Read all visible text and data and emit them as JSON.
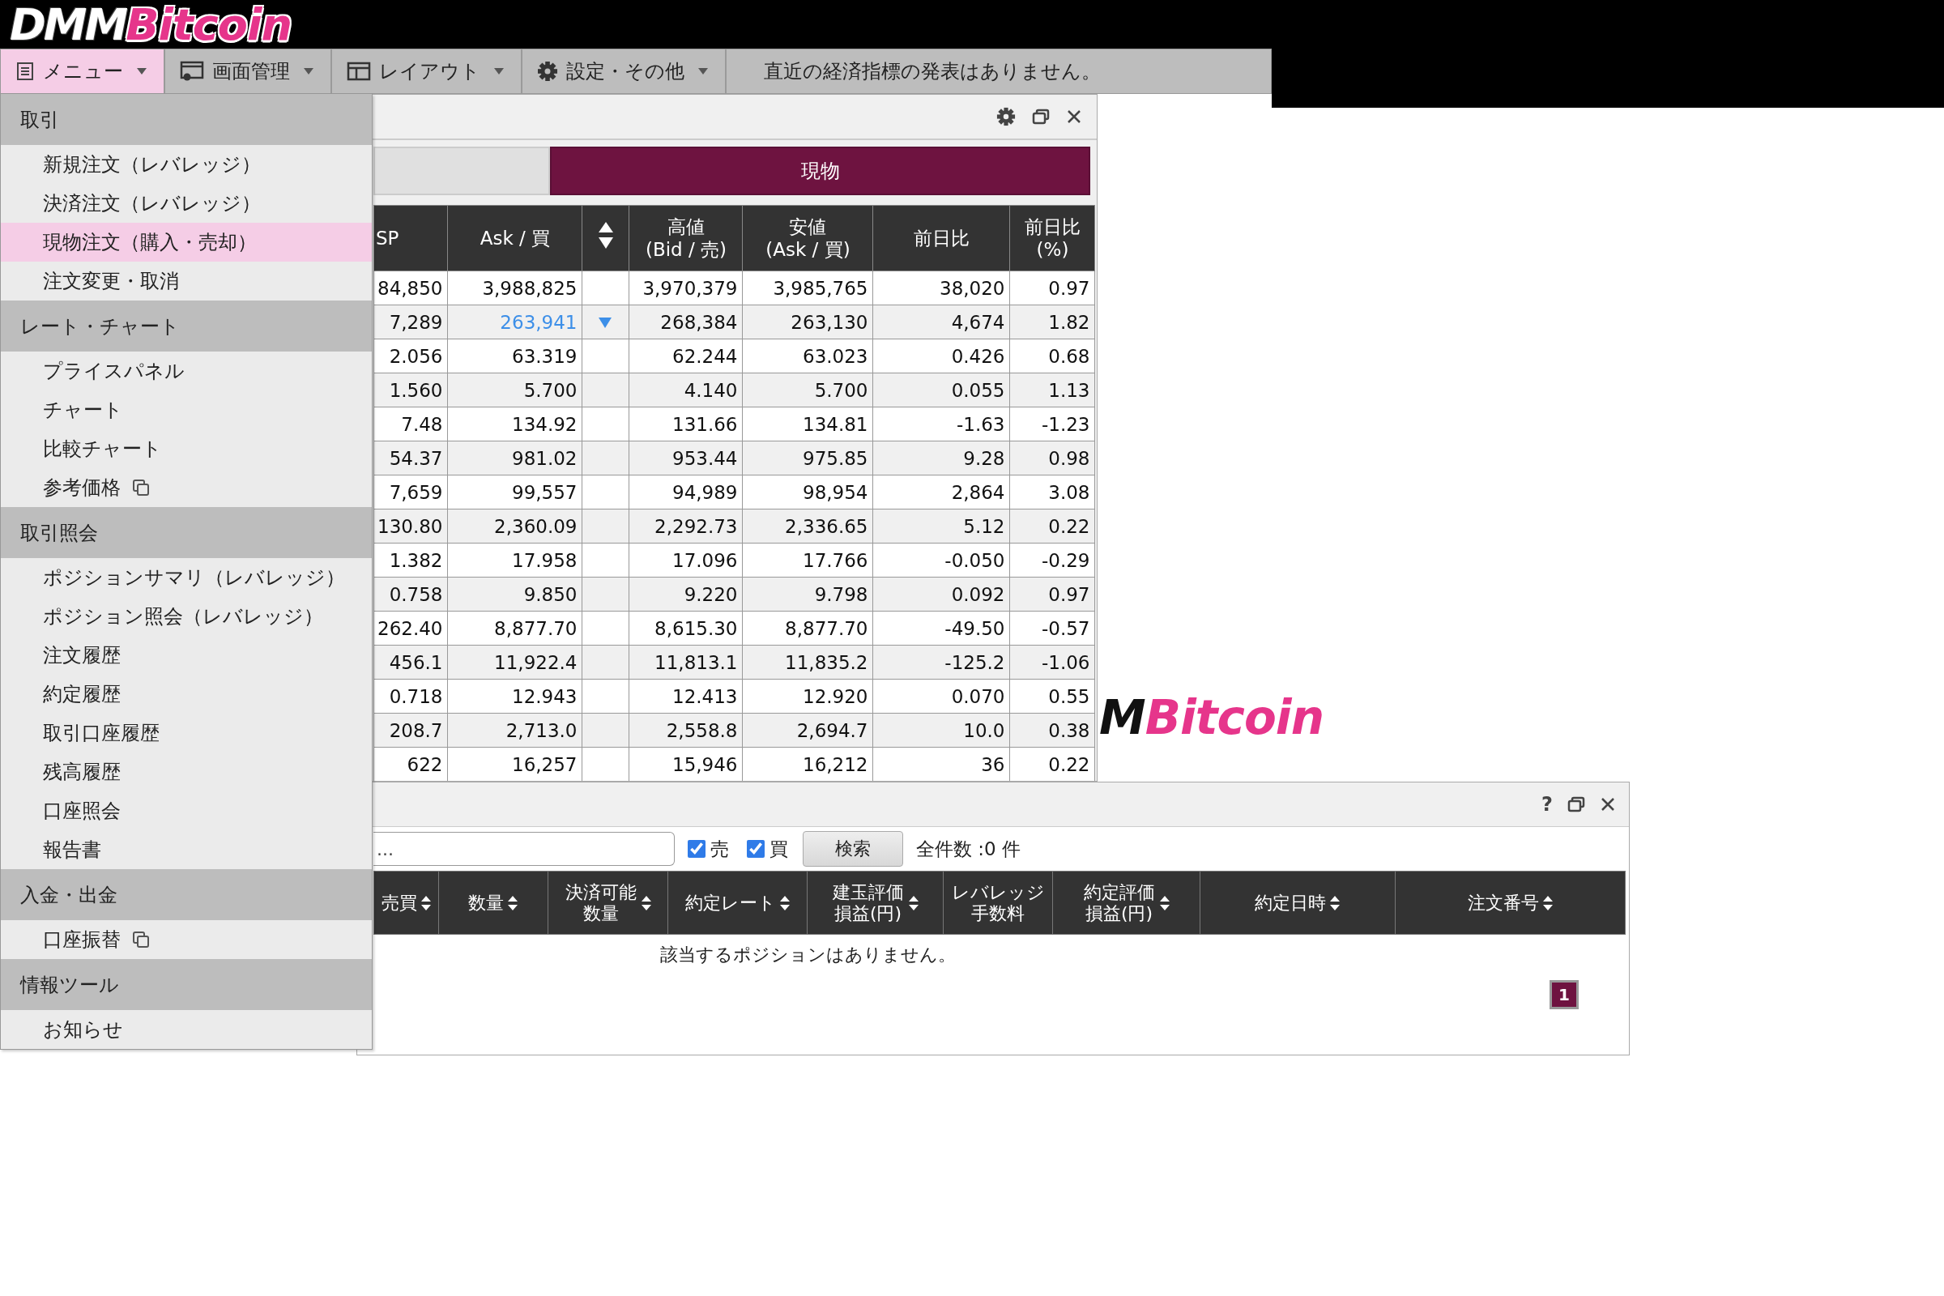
{
  "logo": {
    "part_1": "DMM",
    "part_2": "Bitcoin"
  },
  "toolbar": {
    "buttons": [
      {
        "label": "メニュー",
        "selected": true
      },
      {
        "label": "画面管理",
        "selected": false
      },
      {
        "label": "レイアウト",
        "selected": false
      },
      {
        "label": "設定・その他",
        "selected": false
      }
    ],
    "notice": "直近の経済指標の発表はありません。"
  },
  "menu": {
    "sections": [
      {
        "title": "取引",
        "items": [
          {
            "label": "新規注文（レバレッジ）",
            "selected": false,
            "external": false
          },
          {
            "label": "決済注文（レバレッジ）",
            "selected": false,
            "external": false
          },
          {
            "label": "現物注文（購入・売却）",
            "selected": true,
            "external": false
          },
          {
            "label": "注文変更・取消",
            "selected": false,
            "external": false
          }
        ]
      },
      {
        "title": "レート・チャート",
        "items": [
          {
            "label": "プライスパネル",
            "selected": false,
            "external": false
          },
          {
            "label": "チャート",
            "selected": false,
            "external": false
          },
          {
            "label": "比較チャート",
            "selected": false,
            "external": false
          },
          {
            "label": "参考価格",
            "selected": false,
            "external": true
          }
        ]
      },
      {
        "title": "取引照会",
        "items": [
          {
            "label": "ポジションサマリ（レバレッジ）",
            "selected": false,
            "external": false
          },
          {
            "label": "ポジション照会（レバレッジ）",
            "selected": false,
            "external": false
          },
          {
            "label": "注文履歴",
            "selected": false,
            "external": false
          },
          {
            "label": "約定履歴",
            "selected": false,
            "external": false
          },
          {
            "label": "取引口座履歴",
            "selected": false,
            "external": false
          },
          {
            "label": "残高履歴",
            "selected": false,
            "external": false
          },
          {
            "label": "口座照会",
            "selected": false,
            "external": false
          },
          {
            "label": "報告書",
            "selected": false,
            "external": false
          }
        ]
      },
      {
        "title": "入金・出金",
        "items": [
          {
            "label": "口座振替",
            "selected": false,
            "external": true
          }
        ]
      },
      {
        "title": "情報ツール",
        "items": [
          {
            "label": "お知らせ",
            "selected": false,
            "external": false
          }
        ]
      }
    ]
  },
  "background_logo": "MBitcoin",
  "rate_window": {
    "tabs": [
      {
        "label": "現物",
        "selected": true
      }
    ],
    "columns": [
      {
        "kind": "text",
        "label": "SP"
      },
      {
        "kind": "text",
        "label": "Ask / 買"
      },
      {
        "kind": "tick"
      },
      {
        "kind": "text",
        "label": "高値\n(Bid / 売)"
      },
      {
        "kind": "text",
        "label": "安値\n(Ask / 買)"
      },
      {
        "kind": "text",
        "label": "前日比"
      },
      {
        "kind": "text",
        "label": "前日比\n(%)"
      }
    ],
    "rows": [
      {
        "cells": [
          "84,850",
          "3,988,825",
          "",
          "3,970,379",
          "3,985,765",
          "38,020",
          "0.97"
        ],
        "falling": false
      },
      {
        "cells": [
          "7,289",
          "263,941",
          "",
          "268,384",
          "263,130",
          "4,674",
          "1.82"
        ],
        "falling": true
      },
      {
        "cells": [
          "2.056",
          "63.319",
          "",
          "62.244",
          "63.023",
          "0.426",
          "0.68"
        ],
        "falling": false
      },
      {
        "cells": [
          "1.560",
          "5.700",
          "",
          "4.140",
          "5.700",
          "0.055",
          "1.13"
        ],
        "falling": false
      },
      {
        "cells": [
          "7.48",
          "134.92",
          "",
          "131.66",
          "134.81",
          "-1.63",
          "-1.23"
        ],
        "falling": false
      },
      {
        "cells": [
          "54.37",
          "981.02",
          "",
          "953.44",
          "975.85",
          "9.28",
          "0.98"
        ],
        "falling": false
      },
      {
        "cells": [
          "7,659",
          "99,557",
          "",
          "94,989",
          "98,954",
          "2,864",
          "3.08"
        ],
        "falling": false
      },
      {
        "cells": [
          "130.80",
          "2,360.09",
          "",
          "2,292.73",
          "2,336.65",
          "5.12",
          "0.22"
        ],
        "falling": false
      },
      {
        "cells": [
          "1.382",
          "17.958",
          "",
          "17.096",
          "17.766",
          "-0.050",
          "-0.29"
        ],
        "falling": false
      },
      {
        "cells": [
          "0.758",
          "9.850",
          "",
          "9.220",
          "9.798",
          "0.092",
          "0.97"
        ],
        "falling": false
      },
      {
        "cells": [
          "262.40",
          "8,877.70",
          "",
          "8,615.30",
          "8,877.70",
          "-49.50",
          "-0.57"
        ],
        "falling": false
      },
      {
        "cells": [
          "456.1",
          "11,922.4",
          "",
          "11,813.1",
          "11,835.2",
          "-125.2",
          "-1.06"
        ],
        "falling": false
      },
      {
        "cells": [
          "0.718",
          "12.943",
          "",
          "12.413",
          "12.920",
          "0.070",
          "0.55"
        ],
        "falling": false
      },
      {
        "cells": [
          "208.7",
          "2,713.0",
          "",
          "2,558.8",
          "2,694.7",
          "10.0",
          "0.38"
        ],
        "falling": false
      },
      {
        "cells": [
          "622",
          "16,257",
          "",
          "15,946",
          "16,212",
          "36",
          "0.22"
        ],
        "falling": false
      }
    ]
  },
  "position_window": {
    "help": "?",
    "filter": {
      "placeholder": "...",
      "checkboxes": [
        {
          "label": "売",
          "checked": true
        },
        {
          "label": "買",
          "checked": true
        }
      ],
      "search_button": "検索",
      "count": "全件数 :0 件"
    },
    "columns": [
      {
        "label": "売買"
      },
      {
        "label": "数量"
      },
      {
        "label": "決済可能数量"
      },
      {
        "label": "約定レート"
      },
      {
        "label": "建玉評価損益(円)"
      },
      {
        "label": "レバレッジ手数料",
        "sortable": false
      },
      {
        "label": "約定評価損益(円)"
      },
      {
        "label": "約定日時"
      },
      {
        "label": "注文番号"
      }
    ],
    "empty_message": "該当するポジションはありません。",
    "pagination": [
      {
        "label": "1",
        "selected": true
      }
    ]
  }
}
